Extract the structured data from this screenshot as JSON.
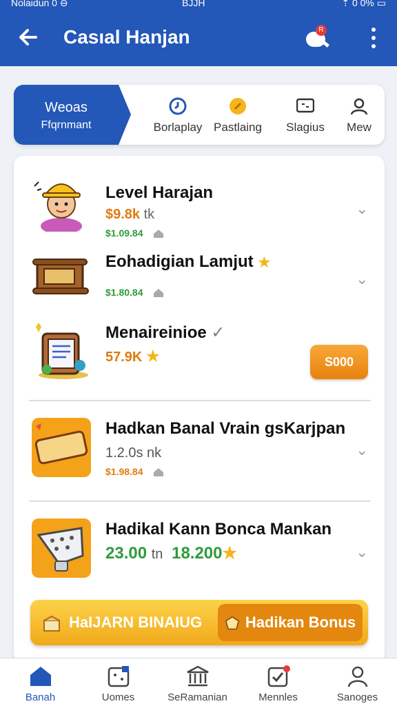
{
  "status_bar": {
    "left": "Nolaidun 0 ⊖",
    "center": "BJJH",
    "right": "⇡ 0 0% ▭"
  },
  "app_bar": {
    "title": "Casıal Hanjan",
    "notification_count": "R"
  },
  "tabs": {
    "active": {
      "line1": "Weoas",
      "line2": "Ffqrnmant"
    },
    "items": [
      {
        "label": "Borlaplay",
        "icon": "clock-icon"
      },
      {
        "label": "Pastlaing",
        "icon": "coin-icon"
      },
      {
        "label": "Slagius",
        "icon": "chat-icon"
      },
      {
        "label": "Mew",
        "icon": "person-icon"
      }
    ]
  },
  "items": [
    {
      "name": "Level Harajan",
      "price": "$9.8k",
      "price_suffix": "tk",
      "sub": "$1.09.84",
      "art": "farmer-avatar"
    },
    {
      "name": "Eohadigian Lamjut",
      "price": "",
      "price_suffix": "",
      "sub": "$1.80.84",
      "art": "wooden-chest"
    },
    {
      "name": "Menaireinioe",
      "price": "57.9K",
      "price_suffix": "",
      "sub": "",
      "art": "clipboard-bag",
      "button": "S000"
    },
    {
      "name": "Hadkan Banal Vrain gsKarjpan",
      "price": "1.2.0s",
      "price_suffix": "nk",
      "sub": "$1.98.84",
      "art": "sale-ticket"
    },
    {
      "name": "Hadikal Kann Bonca Mankan",
      "price": "23.00",
      "price_suffix": "tn",
      "price2": "18.200",
      "sub": "",
      "art": "dice-shaker"
    }
  ],
  "bonus": {
    "left_label": "HaIJARN BINAIUG",
    "right_label": "Hadikan Bonus"
  },
  "bottom_nav": [
    {
      "label": "Banah",
      "icon": "home-icon"
    },
    {
      "label": "Uomes",
      "icon": "game-icon"
    },
    {
      "label": "SeRamanian",
      "icon": "bank-icon"
    },
    {
      "label": "Mennles",
      "icon": "checklist-icon"
    },
    {
      "label": "Sanoges",
      "icon": "profile-icon"
    }
  ],
  "colors": {
    "primary": "#2357b8",
    "accent": "#f39a1e",
    "green": "#2e9b3a",
    "orange_text": "#e07b10"
  }
}
